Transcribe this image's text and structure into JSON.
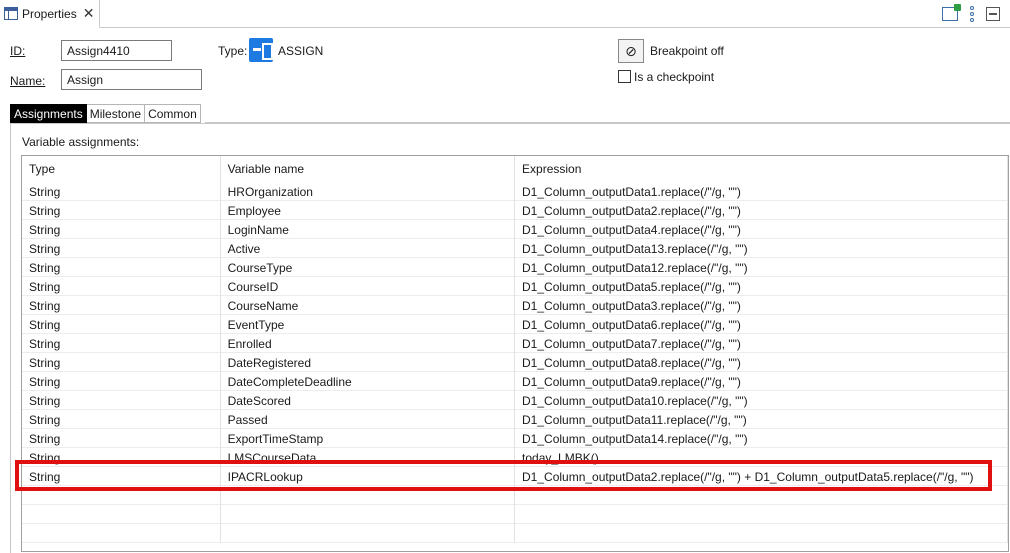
{
  "view": {
    "tab_label": "Properties",
    "close_glyph": "✕"
  },
  "form": {
    "id_label": "ID:",
    "id_value": "Assign4410",
    "name_label": "Name:",
    "name_value": "Assign",
    "type_label": "Type:",
    "type_value": "ASSIGN",
    "breakpoint_label": "Breakpoint off",
    "checkpoint_label": "Is a checkpoint"
  },
  "tabs": [
    {
      "label": "Assignments",
      "active": true
    },
    {
      "label": "Milestone",
      "active": false
    },
    {
      "label": "Common",
      "active": false
    }
  ],
  "section_label": "Variable assignments:",
  "table": {
    "columns": [
      "Type",
      "Variable name",
      "Expression"
    ],
    "rows": [
      [
        "String",
        "HROrganization",
        "D1_Column_outputData1.replace(/\"/g, \"\")"
      ],
      [
        "String",
        "Employee",
        "D1_Column_outputData2.replace(/\"/g, \"\")"
      ],
      [
        "String",
        "LoginName",
        "D1_Column_outputData4.replace(/\"/g, \"\")"
      ],
      [
        "String",
        "Active",
        "D1_Column_outputData13.replace(/\"/g, \"\")"
      ],
      [
        "String",
        "CourseType",
        "D1_Column_outputData12.replace(/\"/g, \"\")"
      ],
      [
        "String",
        "CourseID",
        "D1_Column_outputData5.replace(/\"/g, \"\")"
      ],
      [
        "String",
        "CourseName",
        "D1_Column_outputData3.replace(/\"/g, \"\")"
      ],
      [
        "String",
        "EventType",
        "D1_Column_outputData6.replace(/\"/g, \"\")"
      ],
      [
        "String",
        "Enrolled",
        "D1_Column_outputData7.replace(/\"/g, \"\")"
      ],
      [
        "String",
        "DateRegistered",
        "D1_Column_outputData8.replace(/\"/g, \"\")"
      ],
      [
        "String",
        "DateCompleteDeadline",
        "D1_Column_outputData9.replace(/\"/g, \"\")"
      ],
      [
        "String",
        "DateScored",
        "D1_Column_outputData10.replace(/\"/g, \"\")"
      ],
      [
        "String",
        "Passed",
        "D1_Column_outputData11.replace(/\"/g, \"\")"
      ],
      [
        "String",
        "ExportTimeStamp",
        "D1_Column_outputData14.replace(/\"/g, \"\")"
      ],
      [
        "String",
        "LMSCourseData",
        "today_LMBK()"
      ],
      [
        "String",
        "IPACRLookup",
        "D1_Column_outputData2.replace(/\"/g, \"\") + D1_Column_outputData5.replace(/\"/g, \"\")"
      ]
    ]
  },
  "colors": {
    "highlight": "#e01010",
    "type_icon": "#1c7ae0"
  },
  "icons": {
    "view_tab": "properties-view-icon",
    "type": "assign-icon",
    "breakpoint": "breakpoint-off-icon"
  }
}
